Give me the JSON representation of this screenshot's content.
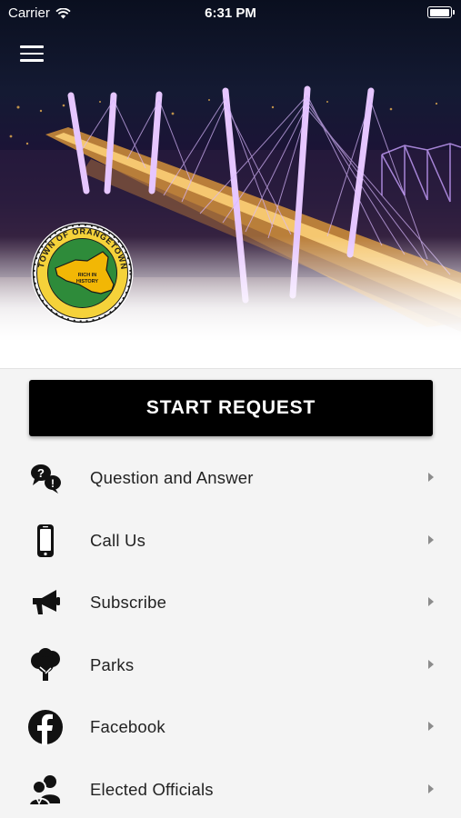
{
  "status_bar": {
    "carrier": "Carrier",
    "time": "6:31 PM",
    "battery_level": 1.0
  },
  "header": {
    "menu_icon": "hamburger-menu-icon",
    "seal": {
      "ring_text": "TOWN OF ORANGETOWN",
      "center_text_line1": "RICH IN",
      "center_text_line2": "HISTORY",
      "colors": {
        "ring": "#2e8b3a",
        "state": "#f2b705",
        "outline": "#1a1a1a"
      }
    }
  },
  "actions": {
    "start_request_label": "START REQUEST"
  },
  "menu": {
    "items": [
      {
        "label": "Question and Answer",
        "icon": "question-bubbles-icon"
      },
      {
        "label": "Call Us",
        "icon": "phone-icon"
      },
      {
        "label": "Subscribe",
        "icon": "megaphone-icon"
      },
      {
        "label": "Parks",
        "icon": "tree-icon"
      },
      {
        "label": "Facebook",
        "icon": "facebook-icon"
      },
      {
        "label": "Elected Officials",
        "icon": "people-icon"
      }
    ]
  },
  "theme": {
    "primary_button": "#000000",
    "background": "#f4f4f4",
    "text": "#222222",
    "chevron": "#8c8c8c"
  }
}
